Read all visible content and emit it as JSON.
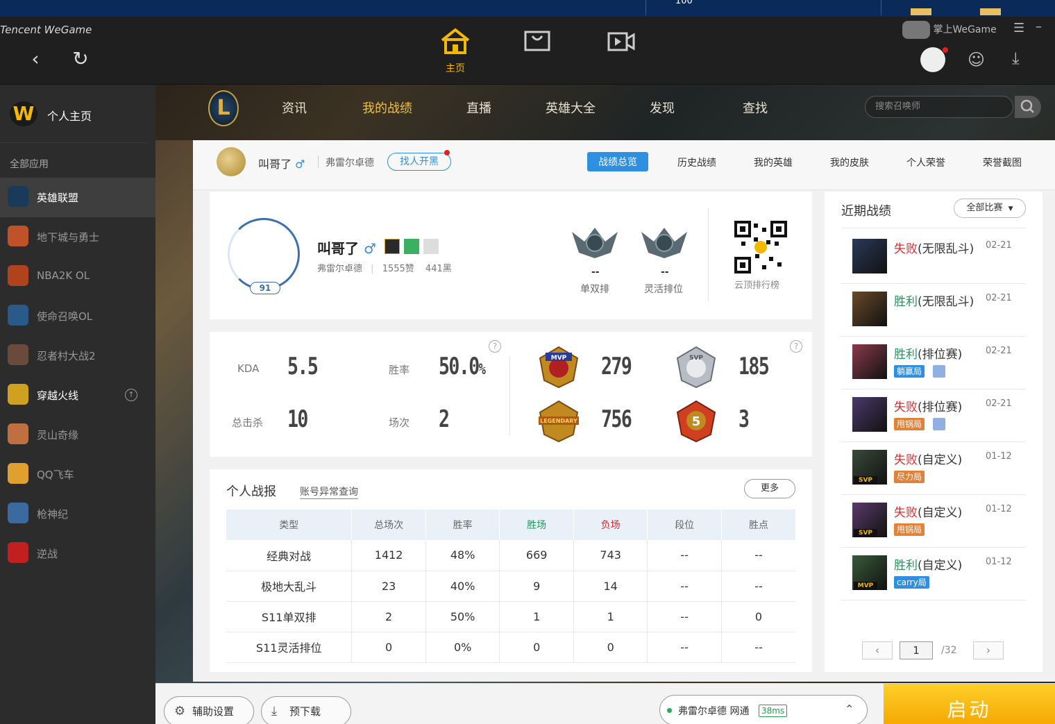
{
  "taskbar": {
    "window_label": "100"
  },
  "app": {
    "brand": "Tencent WeGame",
    "main_tab_home": "主页",
    "account_label": "掌上WeGame"
  },
  "sidebar": {
    "home_label": "个人主页",
    "section_label": "全部应用",
    "items": [
      {
        "label": "英雄联盟",
        "color": "#1a3a5a"
      },
      {
        "label": "地下城与勇士",
        "color": "#c0522a"
      },
      {
        "label": "NBA2K OL",
        "color": "#b0421e"
      },
      {
        "label": "使命召唤OL",
        "color": "#2a5a8a"
      },
      {
        "label": "忍者村大战2",
        "color": "#6a4a3a"
      },
      {
        "label": "穿越火线",
        "color": "#d0a020"
      },
      {
        "label": "灵山奇缘",
        "color": "#c07040"
      },
      {
        "label": "QQ飞车",
        "color": "#e0a030"
      },
      {
        "label": "枪神纪",
        "color": "#3a6aa0"
      },
      {
        "label": "逆战",
        "color": "#c02020"
      }
    ]
  },
  "lol_nav": {
    "items": [
      "资讯",
      "我的战绩",
      "直播",
      "英雄大全",
      "发现",
      "查找"
    ],
    "search_placeholder": "搜索召唤师"
  },
  "profile_bar": {
    "name": "叫哥了",
    "gender": "♂",
    "server": "弗雷尔卓德",
    "find_button": "找人开黑",
    "tabs": [
      "战绩总览",
      "历史战绩",
      "我的英雄",
      "我的皮肤",
      "个人荣誉",
      "荣誉截图"
    ]
  },
  "profile_card": {
    "level": "91",
    "name": "叫哥了",
    "gender": "♂",
    "server": "弗雷尔卓德",
    "likes": "1555赞",
    "blacks": "441黑",
    "rank_solo_value": "--",
    "rank_solo_label": "单双排",
    "rank_flex_value": "--",
    "rank_flex_label": "灵活排位",
    "qr_label": "云顶排行榜"
  },
  "stats": {
    "kda_label": "KDA",
    "kda": "5.5",
    "winrate_label": "胜率",
    "winrate": "50.0",
    "winrate_unit": "%",
    "kills_label": "总击杀",
    "kills": "10",
    "games_label": "场次",
    "games": "2",
    "help": "?",
    "mvp_count": "279",
    "svp_count": "185",
    "legendary_count": "756",
    "penta_count": "3",
    "mvp_text": "MVP",
    "svp_text": "SVP",
    "legendary_text": "LEGENDARY",
    "penta_text": "5"
  },
  "report": {
    "title": "个人战报",
    "link": "账号异常查询",
    "more": "更多",
    "columns": [
      "类型",
      "总场次",
      "胜率",
      "胜场",
      "负场",
      "段位",
      "胜点"
    ],
    "rows": [
      [
        "经典对战",
        "1412",
        "48%",
        "669",
        "743",
        "--",
        "--"
      ],
      [
        "极地大乱斗",
        "23",
        "40%",
        "9",
        "14",
        "--",
        "--"
      ],
      [
        "S11单双排",
        "2",
        "50%",
        "1",
        "1",
        "--",
        "0"
      ],
      [
        "S11灵活排位",
        "0",
        "0%",
        "0",
        "0",
        "--",
        "--"
      ]
    ]
  },
  "recent": {
    "title": "近期战绩",
    "filter": "全部比赛",
    "matches": [
      {
        "result": "失败",
        "mode": "(无限乱斗)",
        "date": "02-21",
        "tag": "",
        "mini": ""
      },
      {
        "result": "胜利",
        "mode": "(无限乱斗)",
        "date": "02-21",
        "tag": "",
        "mini": ""
      },
      {
        "result": "胜利",
        "mode": "(排位赛)",
        "date": "02-21",
        "tag": "躺赢局",
        "mini": ""
      },
      {
        "result": "失败",
        "mode": "(排位赛)",
        "date": "02-21",
        "tag": "甩锅局",
        "mini": ""
      },
      {
        "result": "失败",
        "mode": "(自定义)",
        "date": "01-12",
        "tag": "尽力局",
        "mini": "SVP"
      },
      {
        "result": "失败",
        "mode": "(自定义)",
        "date": "01-12",
        "tag": "甩锅局",
        "mini": "SVP"
      },
      {
        "result": "胜利",
        "mode": "(自定义)",
        "date": "01-12",
        "tag": "carry局",
        "mini": "MVP"
      }
    ],
    "page": "1",
    "total_pages": "/32"
  },
  "bottom": {
    "assist_button": "辅助设置",
    "predownload_button": "预下载",
    "server": "弗雷尔卓德 网通",
    "ping": "38ms",
    "launch": "启动"
  }
}
